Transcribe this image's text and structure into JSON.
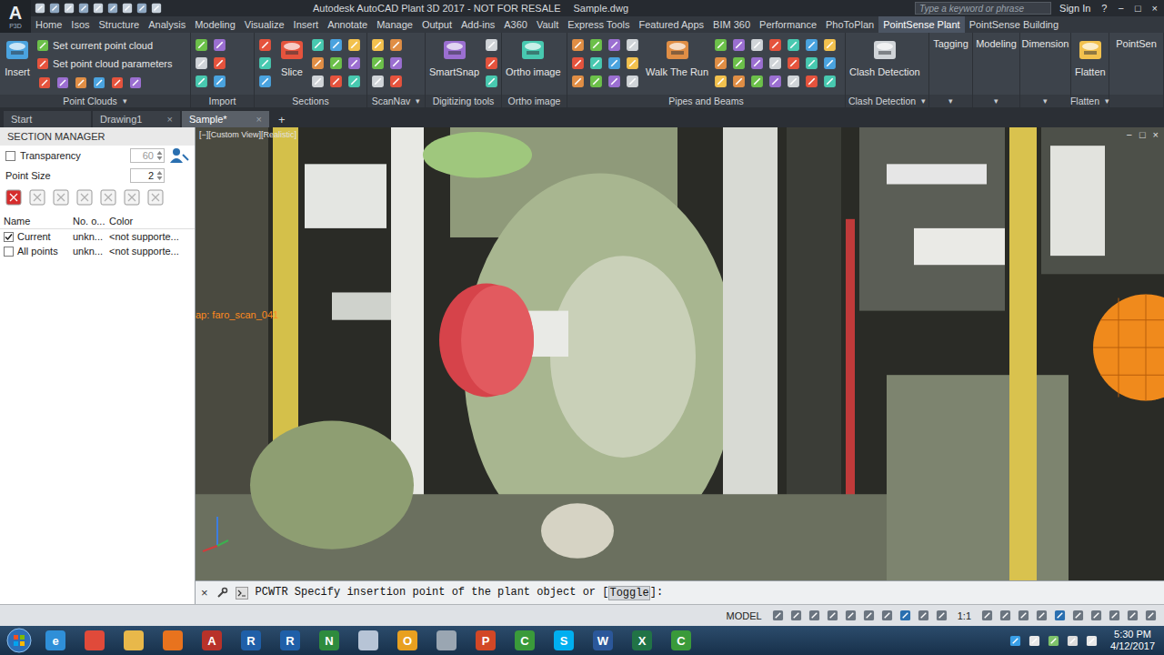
{
  "window": {
    "app_glyph": "A",
    "app_sub": "P3D",
    "title": "Autodesk AutoCAD Plant 3D 2017 - NOT FOR RESALE",
    "file": "Sample.dwg",
    "search_placeholder": "Type a keyword or phrase",
    "sign_in": "Sign In",
    "help": "?",
    "controls": [
      "−",
      "□",
      "×"
    ]
  },
  "ribbon_tabs": [
    {
      "label": "Home",
      "selected": false
    },
    {
      "label": "Isos",
      "selected": false
    },
    {
      "label": "Structure",
      "selected": false
    },
    {
      "label": "Analysis",
      "selected": false
    },
    {
      "label": "Modeling",
      "selected": false
    },
    {
      "label": "Visualize",
      "selected": false
    },
    {
      "label": "Insert",
      "selected": false
    },
    {
      "label": "Annotate",
      "selected": false
    },
    {
      "label": "Manage",
      "selected": false
    },
    {
      "label": "Output",
      "selected": false
    },
    {
      "label": "Add-ins",
      "selected": false
    },
    {
      "label": "A360",
      "selected": false
    },
    {
      "label": "Vault",
      "selected": false
    },
    {
      "label": "Express Tools",
      "selected": false
    },
    {
      "label": "Featured Apps",
      "selected": false
    },
    {
      "label": "BIM 360",
      "selected": false
    },
    {
      "label": "Performance",
      "selected": false
    },
    {
      "label": "PhoToPlan",
      "selected": false
    },
    {
      "label": "PointSense Plant",
      "selected": true
    },
    {
      "label": "PointSense Building",
      "selected": false
    }
  ],
  "ribbon_panels": [
    {
      "label": "Point Clouds",
      "arrow": "▾",
      "kind": "normal",
      "buttons": [
        {
          "label": "Insert",
          "kind": "large"
        },
        {
          "label": "Set current point cloud",
          "kind": "small"
        },
        {
          "label": "Set point cloud parameters",
          "kind": "small"
        }
      ]
    },
    {
      "label": "Import",
      "arrow": "",
      "kind": "normal",
      "buttons": []
    },
    {
      "label": "Sections",
      "arrow": "",
      "kind": "normal",
      "buttons": [
        {
          "label": "Slice",
          "kind": "large"
        }
      ]
    },
    {
      "label": "ScanNav",
      "arrow": "▾",
      "kind": "normal",
      "buttons": []
    },
    {
      "label": "Digitizing tools",
      "arrow": "",
      "kind": "normal",
      "buttons": [
        {
          "label": "SmartSnap",
          "kind": "large"
        }
      ]
    },
    {
      "label": "Ortho image",
      "arrow": "",
      "kind": "normal",
      "buttons": [
        {
          "label": "Ortho image",
          "kind": "large"
        }
      ]
    },
    {
      "label": "Pipes and Beams",
      "arrow": "",
      "kind": "normal",
      "buttons": [
        {
          "label": "Walk The Run",
          "kind": "large"
        }
      ]
    },
    {
      "label": "Clash Detection",
      "arrow": "▾",
      "kind": "normal",
      "buttons": [
        {
          "label": "Clash Detection",
          "kind": "large"
        }
      ]
    },
    {
      "label": "Tagging",
      "arrow": "▾",
      "kind": "collapsed",
      "buttons": []
    },
    {
      "label": "Modeling",
      "arrow": "▾",
      "kind": "collapsed",
      "buttons": []
    },
    {
      "label": "Dimension",
      "arrow": "▾",
      "kind": "collapsed",
      "buttons": []
    },
    {
      "label": "Flatten",
      "arrow": "▾",
      "kind": "normal",
      "buttons": [
        {
          "label": "Flatten",
          "kind": "large"
        }
      ]
    },
    {
      "label": "PointSen",
      "arrow": "",
      "kind": "collapsed",
      "buttons": []
    }
  ],
  "file_tabs": [
    {
      "label": "Start",
      "selected": false,
      "closable": false
    },
    {
      "label": "Drawing1",
      "selected": false,
      "closable": true
    },
    {
      "label": "Sample*",
      "selected": true,
      "closable": true
    }
  ],
  "file_tab_close": "×",
  "new_tab": "+",
  "section_manager": {
    "title": "SECTION MANAGER",
    "transparency": {
      "label": "Transparency",
      "checked": false,
      "value": "60",
      "disabled": true
    },
    "point_size": {
      "label": "Point Size",
      "value": "2",
      "disabled": false
    },
    "columns": [
      "Name",
      "No. o...",
      "Color"
    ],
    "rows": [
      {
        "name": "Current",
        "checked": true,
        "count": "unkn...",
        "color": "<not supporte..."
      },
      {
        "name": "All points",
        "checked": false,
        "count": "unkn...",
        "color": "<not supporte..."
      }
    ]
  },
  "viewport": {
    "label": "[−][Custom View][Realistic]",
    "snap_tooltip": "ap: faro_scan_041",
    "controls": [
      "−",
      "□",
      "×"
    ]
  },
  "command_line": {
    "close": "×",
    "command": "PCWTR",
    "prompt": "Specify insertion point of the plant object or [",
    "option": "Toggle",
    "suffix": "]:"
  },
  "status_bar": {
    "space": "MODEL",
    "scale": "1:1"
  },
  "taskbar": {
    "apps": [
      {
        "glyph": "e",
        "color": "#2f8fd8"
      },
      {
        "glyph": "",
        "color": "#e04a3a"
      },
      {
        "glyph": "",
        "color": "#e8b84a"
      },
      {
        "glyph": "",
        "color": "#e8731e"
      },
      {
        "glyph": "A",
        "color": "#b8322a"
      },
      {
        "glyph": "R",
        "color": "#1f5fa8"
      },
      {
        "glyph": "R",
        "color": "#1f5fa8"
      },
      {
        "glyph": "N",
        "color": "#2e8b3d"
      },
      {
        "glyph": "",
        "color": "#b7c4d6"
      },
      {
        "glyph": "O",
        "color": "#e8a020"
      },
      {
        "glyph": "",
        "color": "#9aa6b2"
      },
      {
        "glyph": "P",
        "color": "#d24726"
      },
      {
        "glyph": "C",
        "color": "#3a9a3a"
      },
      {
        "glyph": "S",
        "color": "#00aff0"
      },
      {
        "glyph": "W",
        "color": "#2b579a"
      },
      {
        "glyph": "X",
        "color": "#217346"
      },
      {
        "glyph": "C",
        "color": "#3a9a3a"
      }
    ],
    "time": "5:30 PM",
    "date": "4/12/2017"
  }
}
